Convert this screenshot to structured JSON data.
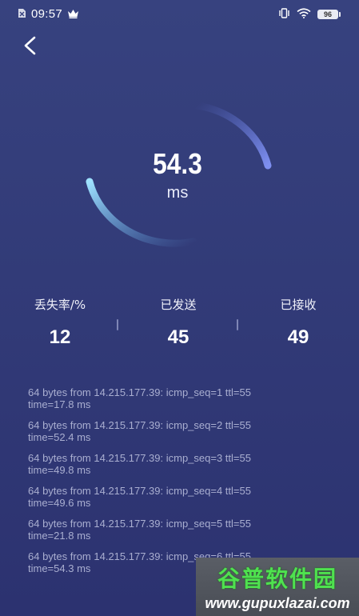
{
  "status_bar": {
    "time": "09:57",
    "battery": "96"
  },
  "gauge": {
    "value": "54.3",
    "unit": "ms",
    "progress_fraction": 0.55
  },
  "stats": [
    {
      "label": "丢失率/%",
      "value": "12"
    },
    {
      "label": "已发送",
      "value": "45"
    },
    {
      "label": "已接收",
      "value": "49"
    }
  ],
  "log": [
    {
      "line1": "64 bytes from 14.215.177.39: icmp_seq=1 ttl=55",
      "line2": "time=17.8 ms"
    },
    {
      "line1": "64 bytes from 14.215.177.39: icmp_seq=2 ttl=55",
      "line2": "time=52.4 ms"
    },
    {
      "line1": "64 bytes from 14.215.177.39: icmp_seq=3 ttl=55",
      "line2": "time=49.8 ms"
    },
    {
      "line1": "64 bytes from 14.215.177.39: icmp_seq=4 ttl=55",
      "line2": "time=49.6 ms"
    },
    {
      "line1": "64 bytes from 14.215.177.39: icmp_seq=5 ttl=55",
      "line2": "time=21.8 ms"
    },
    {
      "line1": "64 bytes from 14.215.177.39: icmp_seq=6 ttl=55",
      "line2": "time=54.3 ms"
    }
  ],
  "watermark": {
    "title": "谷普软件园",
    "url": "www.gupuxlazai.com"
  },
  "icons": {
    "notification": "sim-icon",
    "crown": "crown-icon",
    "vibrate": "vibrate-icon",
    "wifi": "wifi-icon",
    "back": "back-chevron-icon"
  },
  "colors": {
    "gauge_start": "#8fd6ff",
    "gauge_end": "#6f86e6"
  }
}
